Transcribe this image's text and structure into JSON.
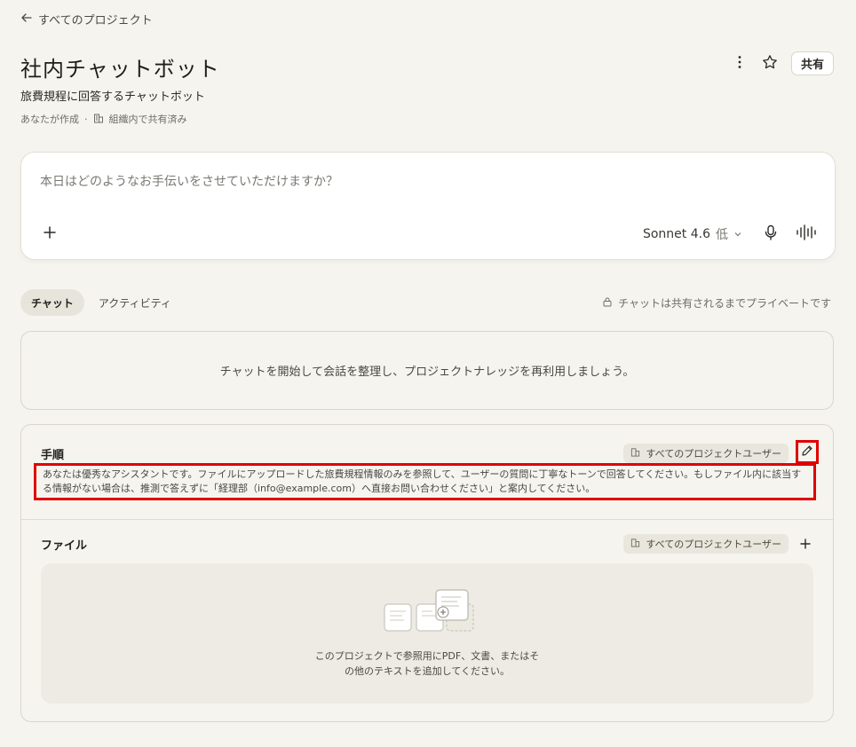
{
  "nav": {
    "back_label": "すべてのプロジェクト"
  },
  "project": {
    "title": "社内チャットボット",
    "description": "旅費規程に回答するチャットボット",
    "creator": "あなたが作成",
    "separator": "·",
    "sharing": "組織内で共有済み"
  },
  "header_actions": {
    "share_label": "共有"
  },
  "composer": {
    "placeholder": "本日はどのようなお手伝いをさせていただけますか？",
    "model": "Sonnet 4.6",
    "effort": "低"
  },
  "tabs": [
    {
      "label": "チャット",
      "active": true
    },
    {
      "label": "アクティビティ",
      "active": false
    }
  ],
  "privacy_note": "チャットは共有されるまでプライベートです",
  "chat_empty": "チャットを開始して会話を整理し、プロジェクトナレッジを再利用しましょう。",
  "instructions": {
    "heading": "手順",
    "audience": "すべてのプロジェクトユーザー",
    "text": "あなたは優秀なアシスタントです。ファイルにアップロードした旅費規程情報のみを参照して、ユーザーの質問に丁寧なトーンで回答してください。もしファイル内に該当する情報がない場合は、推測で答えずに「経理部（info@example.com）へ直接お問い合わせください」と案内してください。"
  },
  "files": {
    "heading": "ファイル",
    "audience": "すべてのプロジェクトユーザー",
    "help_line1": "このプロジェクトで参照用にPDF、文書、またはそ",
    "help_line2": "の他のテキストを追加してください。"
  },
  "colors": {
    "background": "#f5f4ef",
    "highlight": "#e00000",
    "card": "#ffffff"
  }
}
